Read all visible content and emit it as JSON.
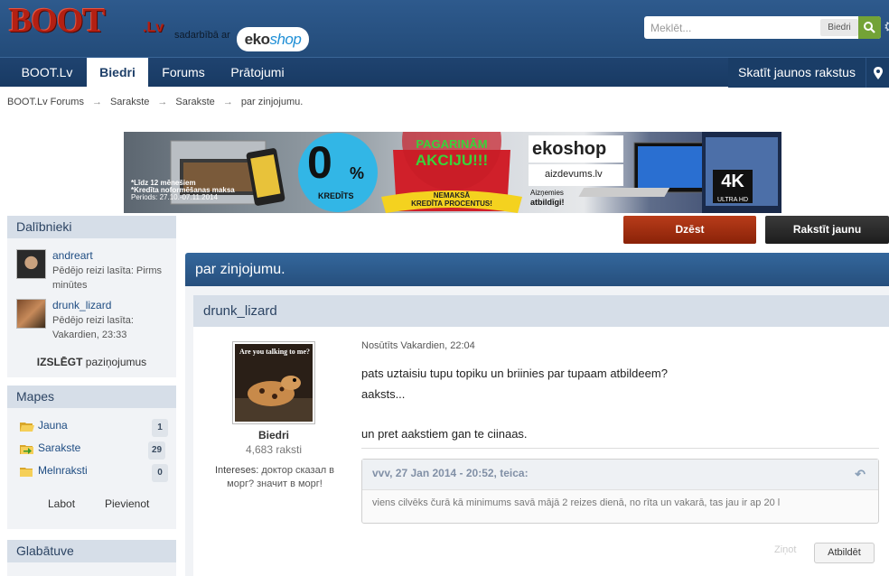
{
  "header": {
    "logo": "BOOT",
    "logo_suffix": ".Lv",
    "partner_text": "sadarbībā ar",
    "partner_logo_main": "eko",
    "partner_logo_accent": "shop"
  },
  "search": {
    "placeholder": "Meklēt...",
    "scope": "Biedri"
  },
  "nav": {
    "tabs": [
      {
        "label": "BOOT.Lv"
      },
      {
        "label": "Biedri"
      },
      {
        "label": "Forums"
      },
      {
        "label": "Prātojumi"
      }
    ],
    "new_posts": "Skatīt jaunos rakstus"
  },
  "breadcrumb": [
    "BOOT.Lv Forums",
    "Sarakste",
    "Sarakste",
    "par zinjojumu."
  ],
  "breadcrumb_separator": "→",
  "banner": {
    "fine_print": [
      "*Līdz 12 mēnešiem",
      "*Kredīta noformēšanas maksa",
      "Periods: 27.10.-07.11.2014"
    ],
    "zero": "0",
    "percent": "%",
    "credit_word": "KREDĪTS",
    "promo_line1": "PAGARINĀM",
    "promo_line2": "AKCIJU!!!",
    "promo_sub1": "NEMAKSĀ",
    "promo_sub2": "KREDĪTA PROCENTUS!",
    "brand": "ekoshop",
    "lender": "aizdevums.lv",
    "lender_slogan1": "Aizņemies",
    "lender_slogan2": "atbildīgi!",
    "tv_badge": "4K",
    "tv_sub": "ULTRA HD"
  },
  "actions": {
    "delete": "Dzēst",
    "write_new": "Rakstīt jaunu"
  },
  "sidebar": {
    "members_title": "Dalībnieki",
    "members": [
      {
        "name": "andreart",
        "seen_1": "Pēdējo reizi lasīta: Pirms",
        "seen_2": "minūtes"
      },
      {
        "name": "drunk_lizard",
        "seen_1": "Pēdējo reizi lasīta:",
        "seen_2": "Vakardien, 23:33"
      }
    ],
    "notify_bold": "IZSLĒGT",
    "notify_rest": " paziņojumus",
    "folders_title": "Mapes",
    "folders": [
      {
        "label": "Jauna",
        "count": "1"
      },
      {
        "label": "Sarakste",
        "count": "29"
      },
      {
        "label": "Melnraksti",
        "count": "0"
      }
    ],
    "folder_edit": "Labot",
    "folder_add": "Pievienot",
    "storage_title": "Glabātuve"
  },
  "thread": {
    "title": "par zinjojumu."
  },
  "post": {
    "author": "drunk_lizard",
    "avatar_caption": "Are you talking to me?",
    "role": "Biedri",
    "posts": "4,683 raksti",
    "interests_label": "Intereses:",
    "interests_value": " доктор сказал в морг? значит в морг!",
    "date": "Nosūtīts Vakardien, 22:04",
    "lines": [
      "pats uztaisiu tupu topiku un briinies par tupaam atbildeem?",
      "aaksts...",
      "un pret aakstiem gan te ciinaas."
    ],
    "quote_head": "vvv, 27 Jan 2014 - 20:52, teica:",
    "quote_text": "viens cilvēks čurā kā minimums savā mājā 2 reizes dienā, no rīta un vakarā, tas jau ir ap 20 l",
    "report": "Ziņot",
    "reply": "Atbildēt"
  },
  "colors": {
    "header_blue": "#2e5a8d",
    "nav_dark": "#1f4370",
    "delete_red": "#a5320f",
    "search_green": "#73a336",
    "link_blue": "#1e4c82"
  }
}
